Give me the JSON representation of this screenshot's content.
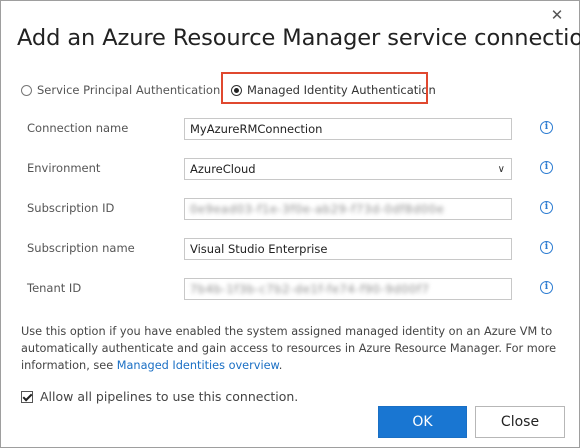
{
  "dialog": {
    "title": "Add an Azure Resource Manager service connection",
    "close_glyph": "✕"
  },
  "auth": {
    "options": [
      {
        "label": "Service Principal Authentication",
        "selected": false
      },
      {
        "label": "Managed Identity Authentication",
        "selected": true
      }
    ],
    "highlight_color": "#e0482f"
  },
  "fields": [
    {
      "label": "Connection name",
      "value": "MyAzureRMConnection",
      "type": "text",
      "redacted": false
    },
    {
      "label": "Environment",
      "value": "AzureCloud",
      "type": "select",
      "redacted": false
    },
    {
      "label": "Subscription ID",
      "value": "0e9ead03-f1e-3f0e-ab29-f73d-0df8d00e",
      "type": "text",
      "redacted": true
    },
    {
      "label": "Subscription name",
      "value": "Visual Studio Enterprise",
      "type": "text",
      "redacted": false
    },
    {
      "label": "Tenant ID",
      "value": "7b4b-1f3b-c7b2-de1f-fe74-f90-9d00f7",
      "type": "text",
      "redacted": true
    }
  ],
  "info_glyph": "i",
  "description": {
    "text": "Use this option if you have enabled the system assigned managed identity on an Azure VM to automatically authenticate and gain access to resources in Azure Resource Manager. For more information, see ",
    "link": "Managed Identities overview",
    "suffix": "."
  },
  "allow_pipelines": {
    "label": "Allow all pipelines to use this connection.",
    "checked": true
  },
  "buttons": {
    "ok": "OK",
    "close": "Close"
  },
  "colors": {
    "accent": "#1976d2",
    "link": "#1a6fc4",
    "info_icon": "#2b7bd1"
  }
}
